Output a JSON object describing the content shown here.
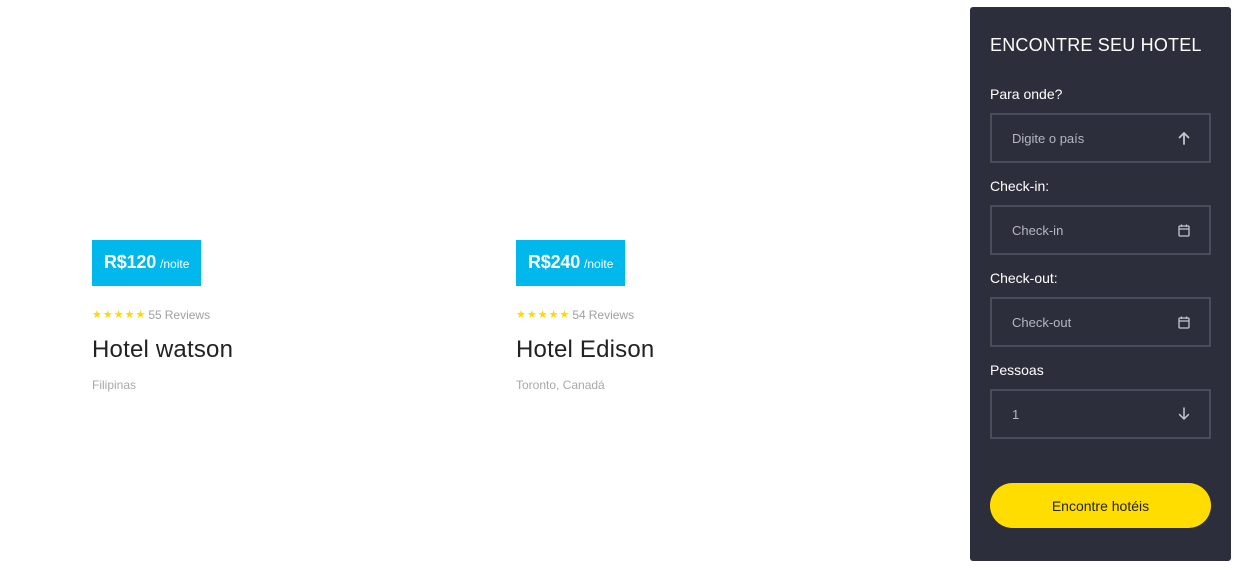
{
  "colors": {
    "badge_bg": "#00b8ec",
    "star": "#ffd800",
    "panel_bg": "#2d2e3b",
    "button_bg": "#ffdd00"
  },
  "hotels": [
    {
      "price": "R$120",
      "price_unit": "/noite",
      "rating_stars": 5,
      "review_count": "55",
      "review_label": "Reviews",
      "name": "Hotel watson",
      "location": "Filipinas"
    },
    {
      "price": "R$240",
      "price_unit": "/noite",
      "rating_stars": 5,
      "review_count": "54",
      "review_label": "Reviews",
      "name": "Hotel Edison",
      "location": "Toronto, Canadá"
    }
  ],
  "search": {
    "title": "ENCONTRE SEU HOTEL",
    "destination": {
      "label": "Para onde?",
      "placeholder": "Digite o país",
      "icon": "arrow-up-icon"
    },
    "checkin": {
      "label": "Check-in:",
      "placeholder": "Check-in",
      "icon": "calendar-icon"
    },
    "checkout": {
      "label": "Check-out:",
      "placeholder": "Check-out",
      "icon": "calendar-icon"
    },
    "people": {
      "label": "Pessoas",
      "value": "1",
      "icon": "arrow-down-icon"
    },
    "submit_label": "Encontre hotéis"
  }
}
